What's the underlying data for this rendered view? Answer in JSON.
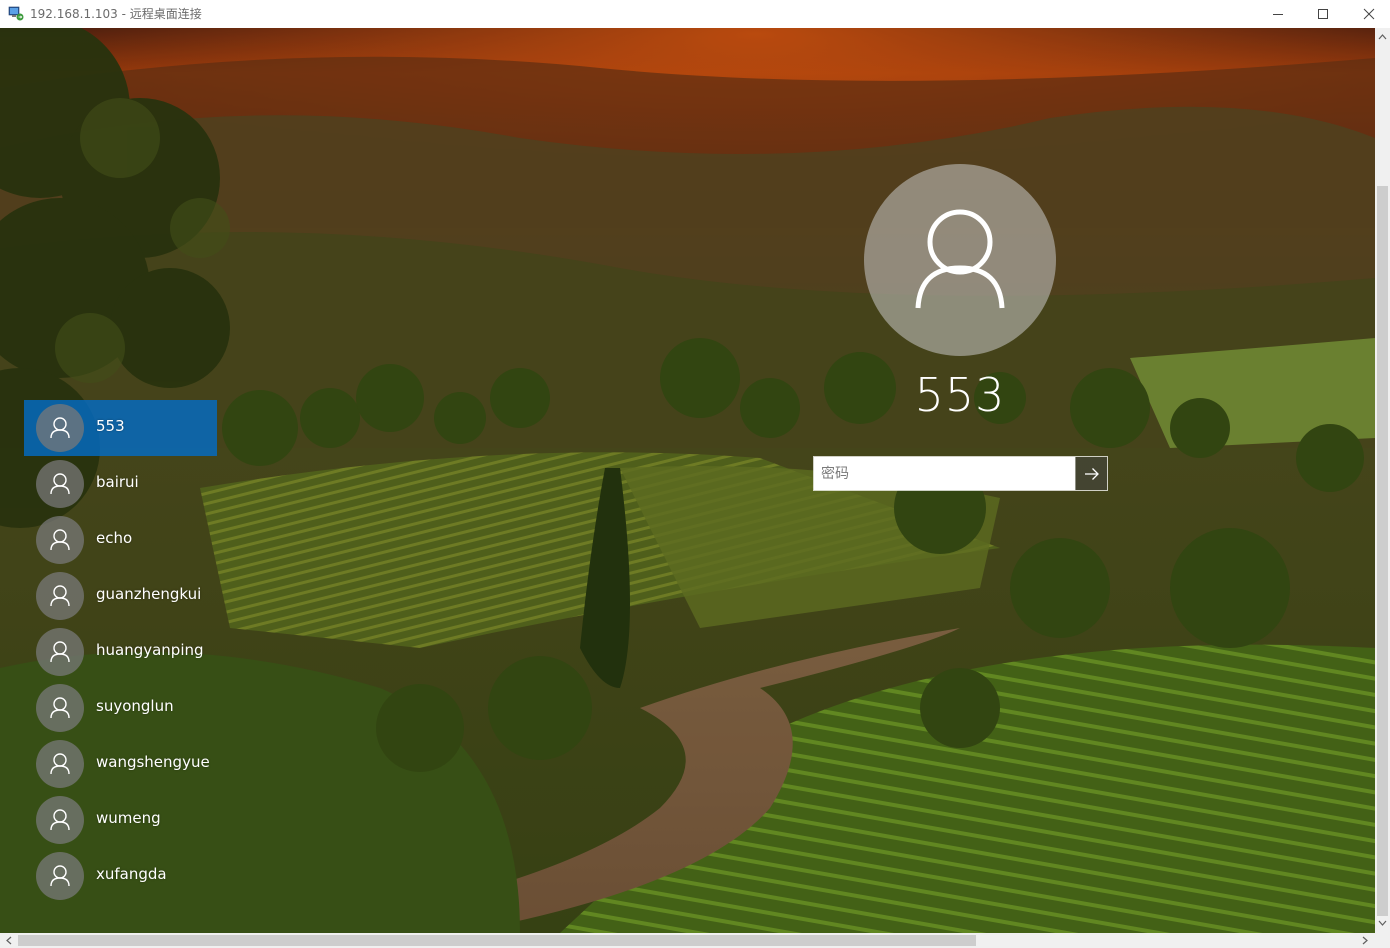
{
  "window": {
    "title": "192.168.1.103 - 远程桌面连接",
    "controls": [
      "minimize",
      "maximize",
      "close"
    ]
  },
  "lock_screen": {
    "current_user": "553",
    "password_placeholder": "密码",
    "submit_icon": "arrow-right-icon",
    "avatar_icon": "user-silhouette-icon",
    "users": [
      {
        "name": "553",
        "selected": true
      },
      {
        "name": "bairui",
        "selected": false
      },
      {
        "name": "echo",
        "selected": false
      },
      {
        "name": "guanzhengkui",
        "selected": false
      },
      {
        "name": "huangyanping",
        "selected": false
      },
      {
        "name": "suyonglun",
        "selected": false
      },
      {
        "name": "wangshengyue",
        "selected": false
      },
      {
        "name": "wumeng",
        "selected": false
      },
      {
        "name": "xufangda",
        "selected": false
      }
    ]
  },
  "colors": {
    "selected_user": "#0a6ecd",
    "titlebar": "#ffffff",
    "scrollbar": "#f0f0f0"
  }
}
